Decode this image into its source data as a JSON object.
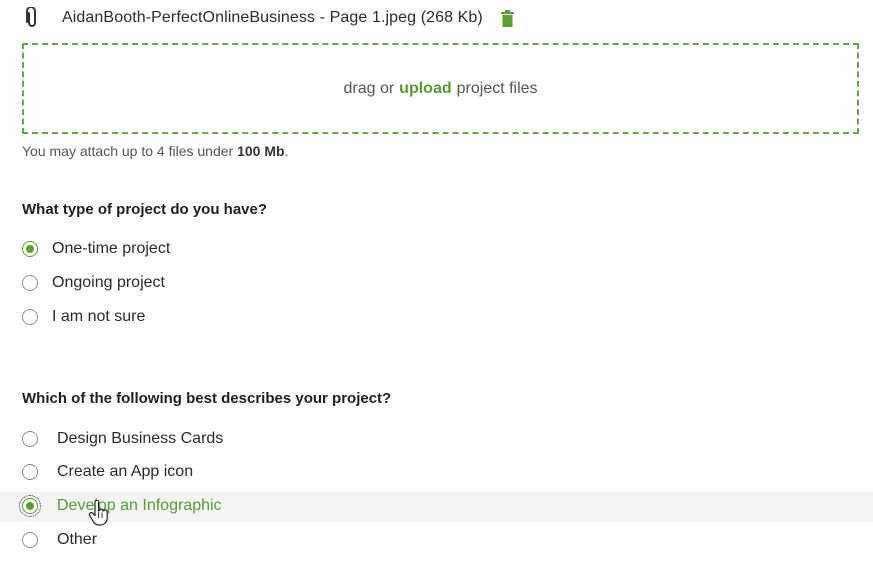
{
  "attachment": {
    "icon": "paperclip-icon",
    "filename": "AidanBooth-PerfectOnlineBusiness - Page 1.jpeg (268 Kb)",
    "delete_icon": "trash-icon",
    "delete_color": "#5aa02c"
  },
  "dropzone": {
    "prefix": "drag or",
    "upload_label": "upload",
    "suffix": "project files",
    "border_color": "#6da54a"
  },
  "note": {
    "prefix": "You may attach up to 4 files under",
    "limit": "100 Mb",
    "suffix": "."
  },
  "project_type": {
    "question": "What type of project do you have?",
    "options": [
      {
        "label": "One-time project",
        "checked": true
      },
      {
        "label": "Ongoing project",
        "checked": false
      },
      {
        "label": "I am not sure",
        "checked": false
      }
    ]
  },
  "project_description": {
    "question": "Which of the following best describes your project?",
    "options": [
      {
        "label": "Design Business Cards",
        "checked": false
      },
      {
        "label": "Create an App icon",
        "checked": false
      },
      {
        "label": "Develop an Infographic",
        "checked": true
      },
      {
        "label": "Other",
        "checked": false
      }
    ]
  },
  "accent_color": "#5aa02c"
}
